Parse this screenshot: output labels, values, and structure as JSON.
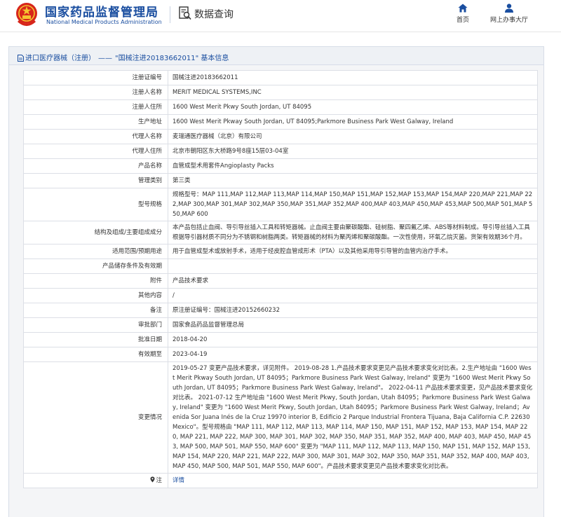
{
  "header": {
    "agency_cn": "国家药品监督管理局",
    "agency_en": "National Medical Products Administration",
    "section_title": "数据查询",
    "nav": [
      {
        "label": "首页",
        "icon": "home-icon"
      },
      {
        "label": "网上办事大厅",
        "icon": "user-icon"
      }
    ]
  },
  "breadcrumb": {
    "category": "进口医疗器械（注册）",
    "separator": "——",
    "title": "\"国械注进20183662011\" 基本信息"
  },
  "record": {
    "rows": [
      {
        "key": "注册证编号",
        "value": "国械注进20183662011"
      },
      {
        "key": "注册人名称",
        "value": "MERIT MEDICAL SYSTEMS,INC"
      },
      {
        "key": "注册人住所",
        "value": "1600 West Merit Pkwy South Jordan, UT 84095"
      },
      {
        "key": "生产地址",
        "value": "1600 West Merit Pkway South Jordan, UT 84095;Parkmore Business Park West Galway, Ireland"
      },
      {
        "key": "代理人名称",
        "value": "麦瑞通医疗器械（北京）有限公司"
      },
      {
        "key": "代理人住所",
        "value": "北京市朝阳区东大桥路9号8座15层03-04室"
      },
      {
        "key": "产品名称",
        "value": "血管成型术用套件Angioplasty Packs"
      },
      {
        "key": "管理类别",
        "value": "第三类"
      },
      {
        "key": "型号规格",
        "value": "规格型号：MAP 111,MAP 112,MAP 113,MAP 114,MAP 150,MAP 151,MAP 152,MAP 153,MAP 154,MAP 220,MAP 221,MAP 222,MAP 300,MAP 301,MAP 302,MAP 350,MAP 351,MAP 352,MAP 400,MAP 403,MAP 450,MAP 453,MAP 500,MAP 501,MAP 550,MAP 600"
      },
      {
        "key": "结构及组成/主要组成成分",
        "value": "本产品包括止血阀、导引导丝插入工具和转矩器械。止血阀主要由聚碳酸酯、硅树脂、聚四氟乙烯、ABS等材料制成。导引导丝插入工具根据导引器材质不同分为不锈钢和树脂两类。转矩器械的材料为聚丙烯和聚碳酸酯。一次性使用，环氧乙烷灭菌。货架有效期36个月。"
      },
      {
        "key": "适用范围/预期用途",
        "value": "用于血管成型术或放射手术，适用于经皮腔血管成形术（PTA）以及其他采用导引导管的血管内治疗手术。"
      },
      {
        "key": "产品储存条件及有效期",
        "value": ""
      },
      {
        "key": "附件",
        "value": "产品技术要求"
      },
      {
        "key": "其他内容",
        "value": "/"
      },
      {
        "key": "备注",
        "value": "原注册证编号：国械注进20152660232"
      },
      {
        "key": "审批部门",
        "value": "国家食品药品监督管理总局"
      },
      {
        "key": "批准日期",
        "value": "2018-04-20"
      },
      {
        "key": "有效期至",
        "value": "2023-04-19"
      },
      {
        "key": "变更情况",
        "value": "2019-05-27 变更产品技术要求，详见附件。 2019-08-28 1.产品技术要求变更见产品技术要求变化对比表。2.生产地址由 \"1600 West Merit Pkway South Jordan, UT 84095；Parkmore Business Park West Galway, Ireland\" 变更为 \"1600 West Merit Pkwy South Jordan, UT 84095；Parkmore Business Park West Galway, Ireland\"。 2022-04-11 产品技术要求变更，见产品技术要求变化对比表。 2021-07-12 生产地址由 \"1600 West Merit Pkwy, South Jordan, Utah 84095；Parkmore Business Park West Galway, Ireland\" 变更为 \"1600 West Merit Pkwy, South Jordan, Utah 84095；Parkmore Business Park West Galway, Ireland；Avenida Sor Juana Inés de la Cruz 19970 interior B, Edificio 2 Parque Industrial Frontera Tijuana, Baja California C.P. 22630 Mexico\"。型号规格由 \"MAP 111, MAP 112, MAP 113, MAP 114, MAP 150, MAP 151, MAP 152, MAP 153, MAP 154, MAP 220, MAP 221, MAP 222, MAP 300, MAP 301, MAP 302, MAP 350, MAP 351, MAP 352, MAP 400, MAP 403, MAP 450, MAP 453, MAP 500, MAP 501, MAP 550, MAP 600\" 变更为 \"MAP 111, MAP 112, MAP 113, MAP 150, MAP 151, MAP 152, MAP 153, MAP 154, MAP 220, MAP 221, MAP 222, MAP 300, MAP 301, MAP 302, MAP 350, MAP 351, MAP 352, MAP 400, MAP 403, MAP 450, MAP 500, MAP 501, MAP 550, MAP 600\"。产品技术要求变更见产品技术要求变化对比表。"
      }
    ],
    "note_row": {
      "key": "注",
      "link_label": "详情",
      "icon": "pin-icon"
    }
  },
  "colors": {
    "brand_blue": "#1a4ea0",
    "emblem_red": "#d7261b",
    "emblem_gold": "#f5c430"
  }
}
